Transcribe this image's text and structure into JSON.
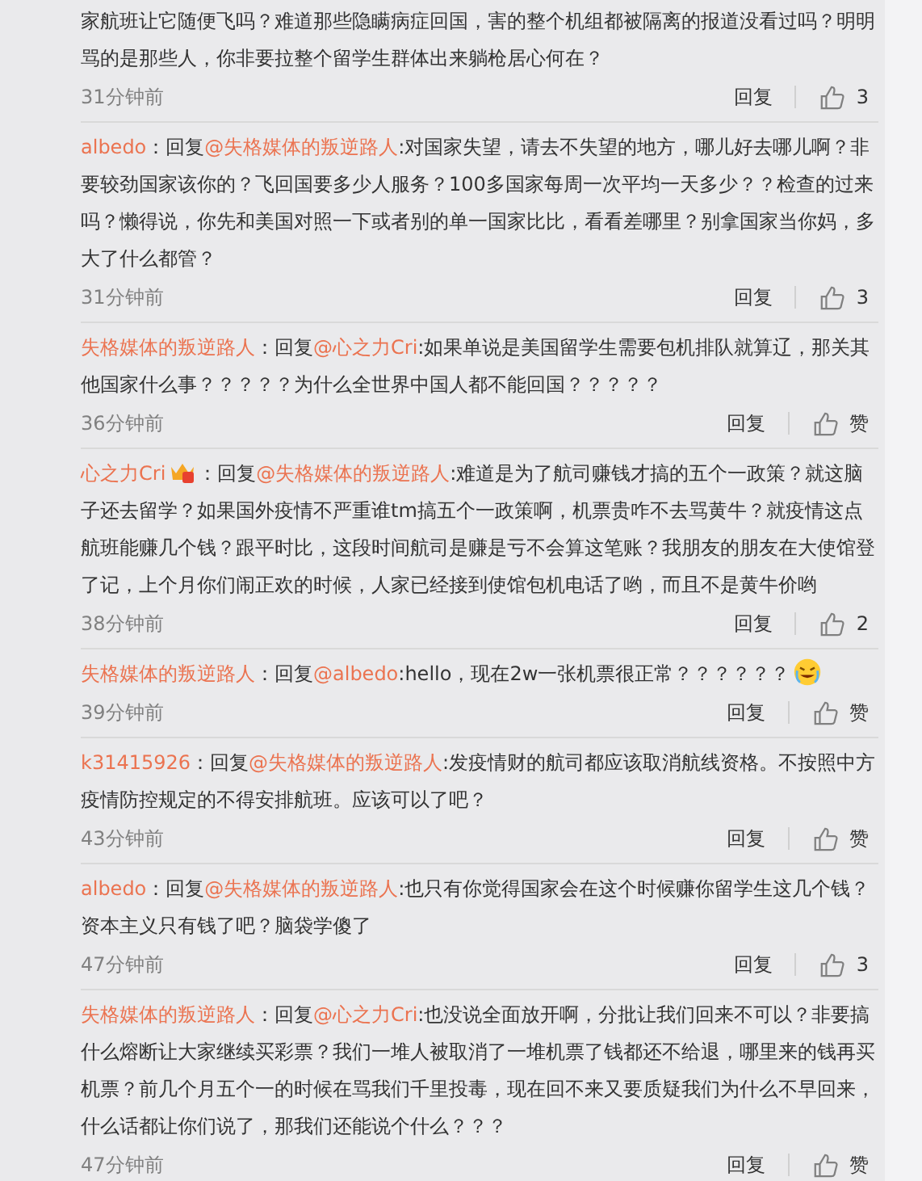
{
  "comments": [
    {
      "text": "家航班让它随便飞吗？难道那些隐瞒病症回国，害的整个机组都被隔离的报道没看过吗？明明骂的是那些人，你非要拉整个留学生群体出来躺枪居心何在？",
      "time": "31分钟前",
      "reply": "回复",
      "likes": "3"
    },
    {
      "user": "albedo",
      "reply_prefix": "：回复",
      "mention": "@失格媒体的叛逆路人",
      "text": ":对国家失望，请去不失望的地方，哪儿好去哪儿啊？非要较劲国家该你的？飞回国要多少人服务？100多国家每周一次平均一天多少？？检查的过来吗？懒得说，你先和美国对照一下或者别的单一国家比比，看看差哪里？别拿国家当你妈，多大了什么都管？",
      "time": "31分钟前",
      "reply": "回复",
      "likes": "3"
    },
    {
      "user": "失格媒体的叛逆路人",
      "reply_prefix": "：回复",
      "mention": "@心之力Cri",
      "text": ":如果单说是美国留学生需要包机排队就算辽，那关其他国家什么事？？？？？为什么全世界中国人都不能回国？？？？？",
      "time": "36分钟前",
      "reply": "回复",
      "likes": "赞"
    },
    {
      "user": "心之力Cri",
      "badge": true,
      "reply_prefix": "：回复",
      "mention": "@失格媒体的叛逆路人",
      "text": ":难道是为了航司赚钱才搞的五个一政策？就这脑子还去留学？如果国外疫情不严重谁tm搞五个一政策啊，机票贵咋不去骂黄牛？就疫情这点航班能赚几个钱？跟平时比，这段时间航司是赚是亏不会算这笔账？我朋友的朋友在大使馆登了记，上个月你们闹正欢的时候，人家已经接到使馆包机电话了哟，而且不是黄牛价哟",
      "time": "38分钟前",
      "reply": "回复",
      "likes": "2"
    },
    {
      "user": "失格媒体的叛逆路人",
      "reply_prefix": "：回复",
      "mention": "@albedo",
      "text": ":hello，现在2w一张机票很正常？？？？？？",
      "emoji": true,
      "time": "39分钟前",
      "reply": "回复",
      "likes": "赞"
    },
    {
      "user": "k31415926",
      "reply_prefix": "：回复",
      "mention": "@失格媒体的叛逆路人",
      "text": ":发疫情财的航司都应该取消航线资格。不按照中方疫情防控规定的不得安排航班。应该可以了吧？",
      "time": "43分钟前",
      "reply": "回复",
      "likes": "赞"
    },
    {
      "user": "albedo",
      "reply_prefix": "：回复",
      "mention": "@失格媒体的叛逆路人",
      "text": ":也只有你觉得国家会在这个时候赚你留学生这几个钱？资本主义只有钱了吧？脑袋学傻了",
      "time": "47分钟前",
      "reply": "回复",
      "likes": "3"
    },
    {
      "user": "失格媒体的叛逆路人",
      "reply_prefix": "：回复",
      "mention": "@心之力Cri",
      "text": ":也没说全面放开啊，分批让我们回来不可以？非要搞什么熔断让大家继续买彩票？我们一堆人被取消了一堆机票了钱都还不给退，哪里来的钱再买机票？前几个月五个一的时候在骂我们千里投毒，现在回不来又要质疑我们为什么不早回来，什么话都让你们说了，那我们还能说个什么？？？",
      "time": "47分钟前",
      "reply": "回复",
      "likes": "赞"
    }
  ]
}
